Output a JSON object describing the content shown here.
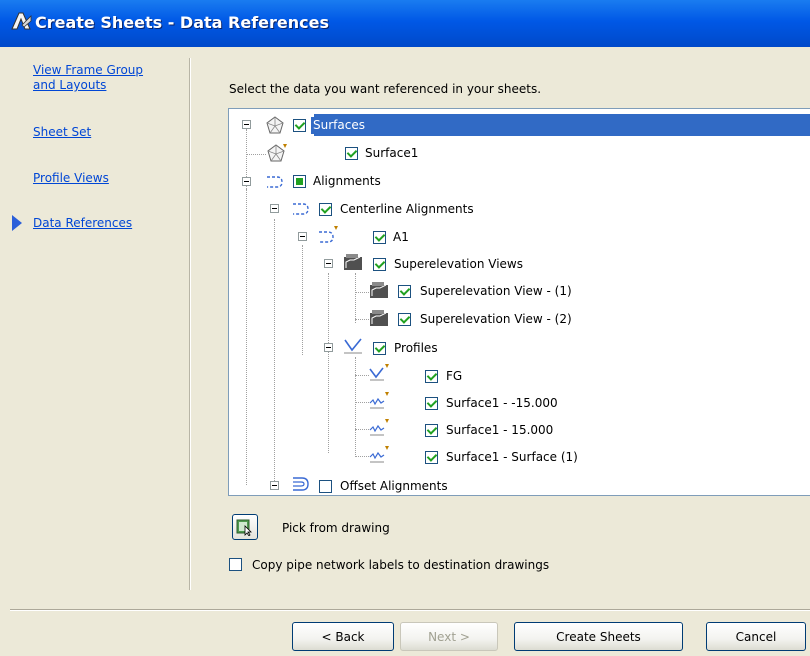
{
  "window": {
    "title": "Create Sheets - Data References",
    "app_icon": "autocad-civil-logo-icon"
  },
  "nav": {
    "items": [
      {
        "label": "View Frame Group \nand Layouts",
        "active": false
      },
      {
        "label": "Sheet Set",
        "active": false
      },
      {
        "label": "Profile Views",
        "active": false
      },
      {
        "label": "Data References",
        "active": true
      }
    ]
  },
  "main": {
    "prompt": "Select the data you want referenced in your sheets.",
    "tree": [
      {
        "label": "Surfaces",
        "state": "checked",
        "icon": "surface-icon",
        "selected": true
      },
      {
        "label": "Surface1",
        "state": "checked",
        "icon": "surface-icon"
      },
      {
        "label": "Alignments",
        "state": "partial",
        "icon": "alignment-icon"
      },
      {
        "label": "Centerline Alignments",
        "state": "checked",
        "icon": "alignment-icon"
      },
      {
        "label": "A1",
        "state": "checked",
        "icon": "alignment-icon"
      },
      {
        "label": "Superelevation Views",
        "state": "checked",
        "icon": "superelevation-view-icon"
      },
      {
        "label": "Superelevation View - (1)",
        "state": "checked",
        "icon": "superelevation-view-icon"
      },
      {
        "label": "Superelevation View - (2)",
        "state": "checked",
        "icon": "superelevation-view-icon"
      },
      {
        "label": "Profiles",
        "state": "checked",
        "icon": "profile-icon"
      },
      {
        "label": "FG",
        "state": "checked",
        "icon": "profile-icon"
      },
      {
        "label": "Surface1 - -15.000",
        "state": "checked",
        "icon": "surface-profile-icon"
      },
      {
        "label": "Surface1 - 15.000",
        "state": "checked",
        "icon": "surface-profile-icon"
      },
      {
        "label": "Surface1 - Surface (1)",
        "state": "checked",
        "icon": "surface-profile-icon"
      },
      {
        "label": "Offset Alignments",
        "state": "unchecked",
        "icon": "offset-alignment-icon"
      }
    ],
    "pick_label": "Pick from drawing",
    "copy_label": "Copy pipe network labels to destination drawings",
    "copy_checked": false
  },
  "buttons": {
    "back": "< Back",
    "next": "Next >",
    "create": "Create Sheets",
    "cancel": "Cancel"
  }
}
